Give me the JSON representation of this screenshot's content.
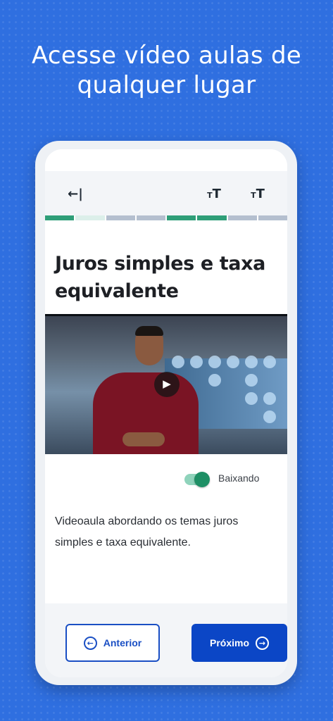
{
  "headline": {
    "line1": "Acesse vídeo aulas de",
    "line2": "qualquer lugar"
  },
  "toolbar": {
    "back_icon": "exit-arrow-icon",
    "font_icon_1": "text-size-icon",
    "font_icon_2": "text-size-icon"
  },
  "progress": {
    "segments": [
      "complete",
      "current",
      "pending",
      "pending",
      "complete",
      "complete",
      "pending",
      "pending"
    ],
    "colors": {
      "complete": "#2e9e78",
      "current": "#dcefea",
      "pending": "#b4bfcf"
    }
  },
  "lesson": {
    "title": "Juros simples e taxa equivalente",
    "description": "Videoaula abordando os temas juros simples e taxa equivalente."
  },
  "video": {
    "play_icon": "play-icon"
  },
  "download": {
    "label": "Baixando",
    "toggle_on": true
  },
  "navigation": {
    "prev_label": "Anterior",
    "next_label": "Próximo"
  },
  "colors": {
    "background": "#2f6fe0",
    "accent": "#0b46c6",
    "toggle": "#1e8f65"
  }
}
